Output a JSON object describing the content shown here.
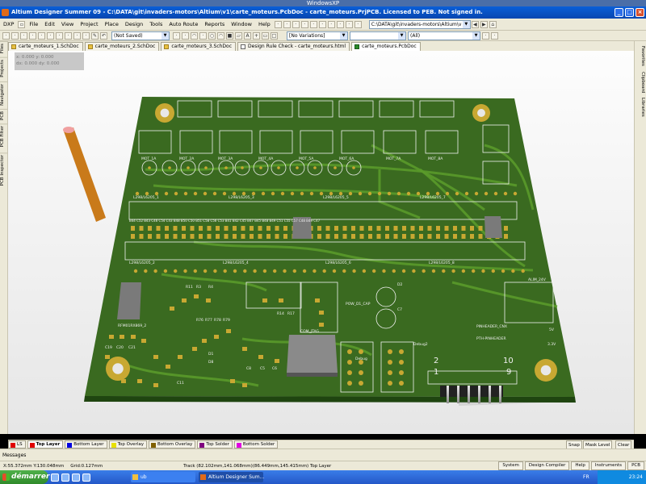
{
  "host": {
    "title": "WindowsXP"
  },
  "window": {
    "title": "Altium Designer Summer 09 - C:\\DATA\\git\\invaders-motors\\Altium\\v1\\carte_moteurs.PcbDoc - carte_moteurs.PrjPCB. Licensed to PEB. Not signed in."
  },
  "menu": {
    "items": [
      "DXP",
      "File",
      "Edit",
      "View",
      "Project",
      "Place",
      "Design",
      "Tools",
      "Auto Route",
      "Reports",
      "Window",
      "Help"
    ]
  },
  "toolbar": {
    "saved_state": "(Not Saved)",
    "path": "C:\\DATA\\git\\invaders-motors\\Altium\\v",
    "variations": "[No Variations]",
    "filter": "(All)"
  },
  "doc_tabs": [
    {
      "label": "carte_moteurs_1.SchDoc",
      "kind": "sch"
    },
    {
      "label": "carte_moteurs_2.SchDoc",
      "kind": "sch"
    },
    {
      "label": "carte_moteurs_3.SchDoc",
      "kind": "sch"
    },
    {
      "label": "Design Rule Check - carte_moteurs.html",
      "kind": "html"
    },
    {
      "label": "carte_moteurs.PcbDoc",
      "kind": "pcb"
    }
  ],
  "left_panels": [
    "Files",
    "Projects",
    "Navigator",
    "PCB",
    "PCB Filter",
    "PCB Inspector"
  ],
  "right_panels": [
    "Favorites",
    "Clipboard",
    "Libraries"
  ],
  "coord_overlay": {
    "line1": "x: 0.000 y: 0.000",
    "line2": "dx: 0.000 dy: 0.000"
  },
  "layer_tabs": [
    {
      "label": "LS",
      "color": "#e00000"
    },
    {
      "label": "Top Layer",
      "color": "#e00000",
      "active": true
    },
    {
      "label": "Bottom Layer",
      "color": "#0000e0"
    },
    {
      "label": "Top Overlay",
      "color": "#e8e000"
    },
    {
      "label": "Bottom Overlay",
      "color": "#806000"
    },
    {
      "label": "Top Solder",
      "color": "#800080"
    },
    {
      "label": "Bottom Solder",
      "color": "#e000e0"
    }
  ],
  "layer_buttons": {
    "snap": "Snap",
    "mask": "Mask Level",
    "clear": "Clear"
  },
  "messages": {
    "label": "Messages"
  },
  "status": {
    "coords": "X:55.372mm Y:130.048mm",
    "grid": "Grid:0.127mm",
    "track": "Track (82.102mm,141.068mm)(86.449mm,145.415mm) Top Layer",
    "buttons": [
      "System",
      "Design Compiler",
      "Help",
      "Instruments",
      "PCB"
    ]
  },
  "taskbar": {
    "start": "démarrer",
    "tasks": [
      {
        "label": "ub",
        "active": false
      },
      {
        "label": "Altium Designer Sum...",
        "active": true
      }
    ],
    "lang": "FR",
    "clock": "23:24"
  },
  "pcb": {
    "labels": {
      "mot": [
        "MOT_1A",
        "MOT_2A",
        "MOT_3A",
        "MOT_4A",
        "MOT_5A",
        "MOT_6A",
        "MOT_7A",
        "MOT_8A"
      ],
      "drivers": [
        "L298/L6205_1",
        "L298/L6205_3",
        "L298/L6205_5",
        "L298/L6205_7",
        "L298/L6205_2",
        "L298/L6205_4",
        "L298/L6205_6",
        "L298/L6205_8"
      ],
      "caps_row": "B44 C52 B43 C46 C54 C43 B48 B50 C50 B51 C58 C56 C53 B41 B42 C45 B47 B45 B48 B49 C51 C55 C57 C48 B49 C47",
      "silk": [
        "RFM01RX869_2",
        "POW_D1_CAP",
        "PINHEADER_CNX",
        "COM_JTAG",
        "Debug",
        "Debug2",
        "PTH-PINHEADER",
        "5V",
        "3.3V",
        "ALIM_24V",
        "R11",
        "R3",
        "R4",
        "R76",
        "R77",
        "R78",
        "R79",
        "R14",
        "R17",
        "C11",
        "C19",
        "C20",
        "C21",
        "D1",
        "D2",
        "C8",
        "C5",
        "C6",
        "C7",
        "D8",
        "1",
        "2",
        "9",
        "10"
      ]
    },
    "colors": {
      "board": "#2d5d18",
      "board_dark": "#1f4510",
      "trace": "#5a9a2a",
      "pad": "#c8a832",
      "silk": "#f0f0f0",
      "chip": "#7a7a7a"
    }
  }
}
